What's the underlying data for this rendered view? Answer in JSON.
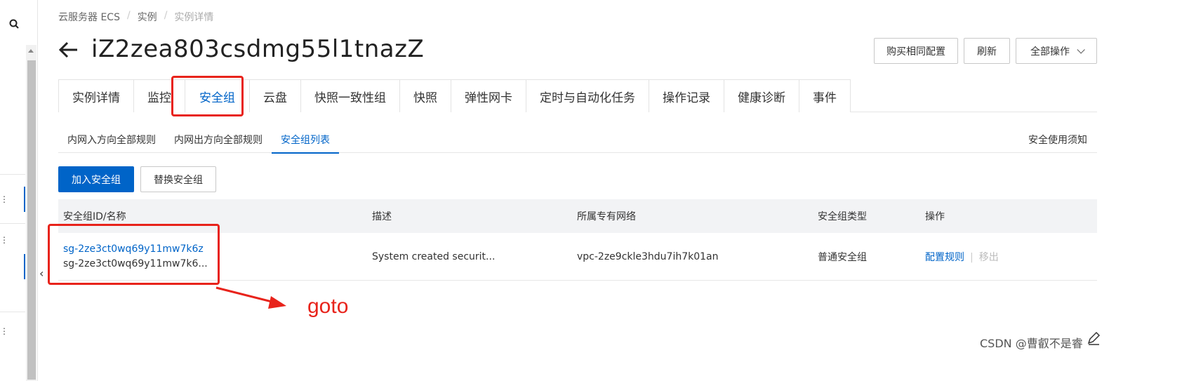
{
  "breadcrumb": {
    "item1": "云服务器 ECS",
    "sep": "/",
    "item2": "实例",
    "current": "实例详情"
  },
  "title": "iZ2zea803csdmg55l1tnazZ",
  "header_buttons": {
    "buy_same": "购买相同配置",
    "refresh": "刷新",
    "all_actions": "全部操作"
  },
  "tabs": [
    {
      "label": "实例详情"
    },
    {
      "label": "监控"
    },
    {
      "label": "安全组"
    },
    {
      "label": "云盘"
    },
    {
      "label": "快照一致性组"
    },
    {
      "label": "快照"
    },
    {
      "label": "弹性网卡"
    },
    {
      "label": "定时与自动化任务"
    },
    {
      "label": "操作记录"
    },
    {
      "label": "健康诊断"
    },
    {
      "label": "事件"
    }
  ],
  "subtabs": [
    {
      "label": "内网入方向全部规则"
    },
    {
      "label": "内网出方向全部规则"
    },
    {
      "label": "安全组列表"
    }
  ],
  "notice": "安全使用须知",
  "actions": {
    "add": "加入安全组",
    "replace": "替换安全组"
  },
  "table": {
    "headers": {
      "id_name": "安全组ID/名称",
      "desc": "描述",
      "vpc": "所属专有网络",
      "type": "安全组类型",
      "ops": "操作"
    },
    "rows": [
      {
        "id": "sg-2ze3ct0wq69y11mw7k6z",
        "name": "sg-2ze3ct0wq69y11mw7k6...",
        "desc": "System created securit...",
        "vpc": "vpc-2ze9ckle3hdu7ih7k01an",
        "type": "普通安全组",
        "op_config": "配置规则",
        "op_sep": "|",
        "op_remove": "移出"
      }
    ]
  },
  "annotation": {
    "text": "goto",
    "color": "#e8231b"
  },
  "watermark": "CSDN @曹叡不是睿",
  "colors": {
    "primary": "#0064c8",
    "annotation_red": "#e8231b"
  }
}
